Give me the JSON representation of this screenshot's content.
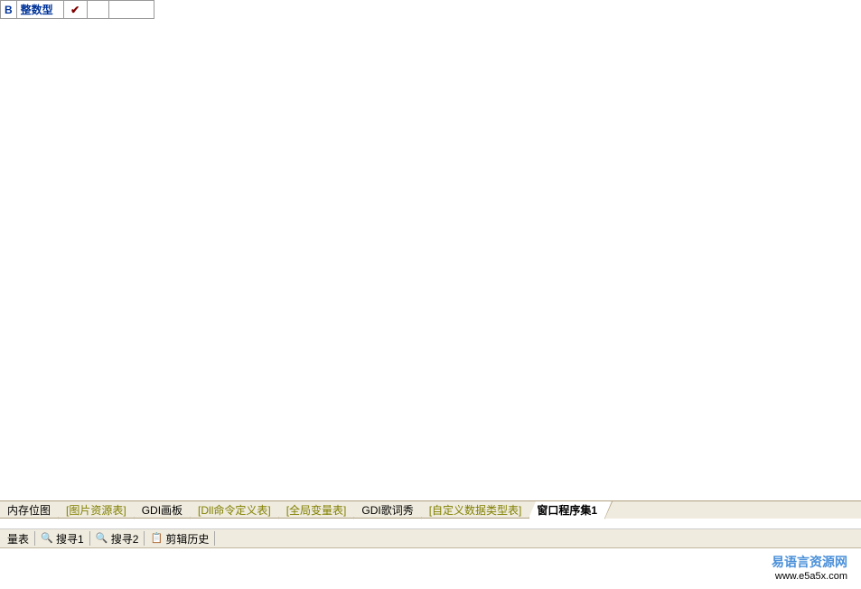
{
  "top_row": {
    "col1": "B",
    "col2": "整数型",
    "check": "✔"
  },
  "tabs": [
    {
      "label": "内存位图",
      "style": "black"
    },
    {
      "label": "[图片资源表]",
      "style": "olive"
    },
    {
      "label": "GDI画板",
      "style": "black"
    },
    {
      "label": "[Dll命令定义表]",
      "style": "olive"
    },
    {
      "label": "[全局变量表]",
      "style": "olive"
    },
    {
      "label": "GDI歌词秀",
      "style": "black"
    },
    {
      "label": "[自定义数据类型表]",
      "style": "olive"
    },
    {
      "label": "窗口程序集1",
      "style": "black",
      "active": true
    }
  ],
  "toolbar": [
    {
      "icon": "",
      "label": "量表"
    },
    {
      "icon": "🔍",
      "label": "搜寻1"
    },
    {
      "icon": "🔍",
      "label": "搜寻2"
    },
    {
      "icon": "📋",
      "label": "剪辑历史"
    }
  ],
  "watermark": {
    "line1": "易语言资源网",
    "line2": "www.e5a5x.com"
  }
}
